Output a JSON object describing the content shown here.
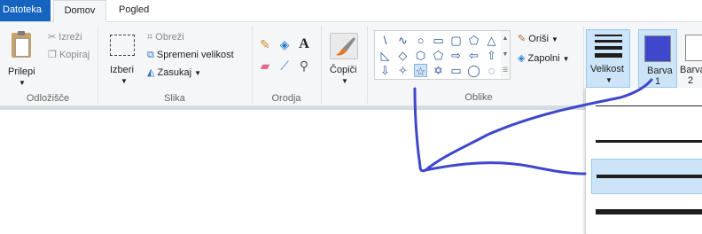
{
  "tabs": {
    "file": "Datoteka",
    "home": "Domov",
    "view": "Pogled"
  },
  "clipboard": {
    "paste": "Prilepi",
    "cut": "Izreži",
    "copy": "Kopiraj",
    "group_label": "Odložišče"
  },
  "image": {
    "select": "Izberi",
    "crop": "Obreži",
    "resize": "Spremeni velikost",
    "rotate": "Zasukaj",
    "group_label": "Slika"
  },
  "tools": {
    "group_label": "Orodja",
    "text_glyph": "A"
  },
  "brushes": {
    "label": "Čopiči"
  },
  "shapes": {
    "outline": "Oriši",
    "fill": "Zapolni",
    "group_label": "Oblike",
    "row1": [
      "\\",
      "∿",
      "○",
      "▭",
      "▢",
      "⬠",
      "△"
    ],
    "row2": [
      "◺",
      "◇",
      "⬡",
      "⬠",
      "⇨",
      "⇦",
      "⇧"
    ],
    "row3": [
      "⇩",
      "✧",
      "☆",
      "✡",
      "▭",
      "◯",
      "◌"
    ]
  },
  "size": {
    "label": "Velikost"
  },
  "colors": {
    "color1_label": "Barva",
    "color1_num": "1",
    "color2_label": "Barva",
    "color2_num": "2",
    "color1_value": "#3f48cc",
    "color2_value": "#ffffff"
  },
  "accent": "#1565c0",
  "stroke_color": "#3f48cc"
}
